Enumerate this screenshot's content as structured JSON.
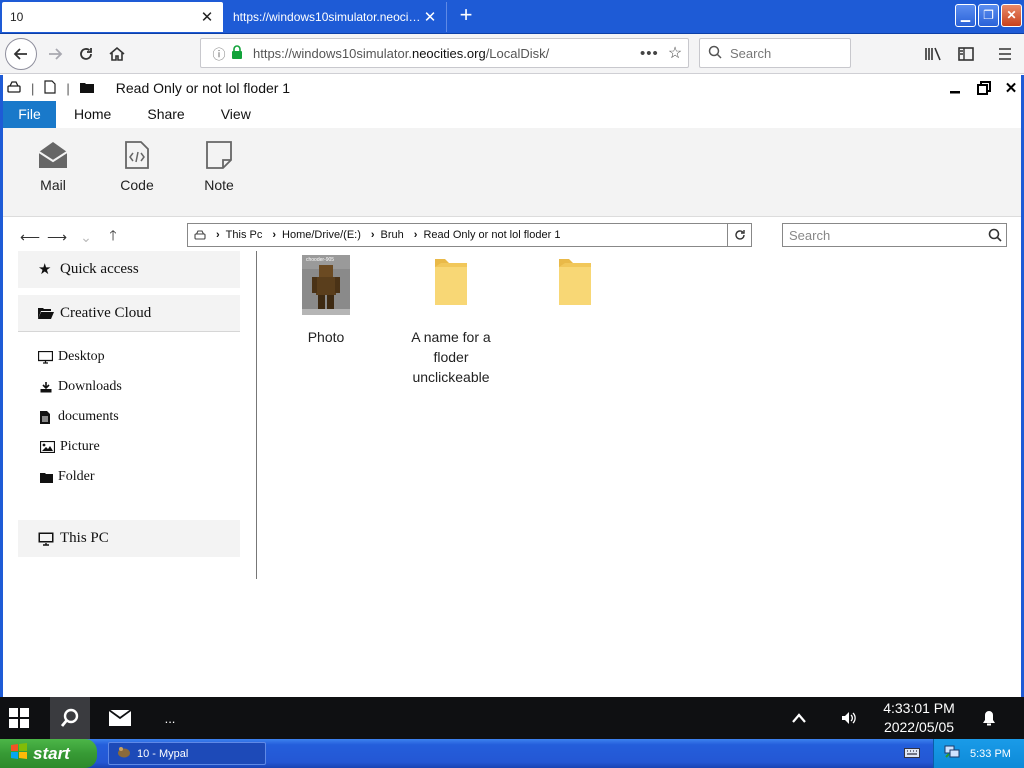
{
  "browser": {
    "tabs": [
      {
        "title": "10",
        "active": true
      },
      {
        "title": "https://windows10simulator.neocities.org/LocalDisk",
        "active": false
      }
    ],
    "url": {
      "prefix": "https://windows10simulator.",
      "domain": "neocities.org",
      "path": "/LocalDisk/"
    },
    "search_placeholder": "Search",
    "icons": [
      "back-icon",
      "forward-icon",
      "reload-icon",
      "home-icon",
      "info-icon",
      "lock-icon",
      "bookmark-star-icon",
      "library-icon",
      "sidebar-icon",
      "menu-icon"
    ]
  },
  "explorer": {
    "title": "Read Only or not lol floder 1",
    "ribbon_tabs": [
      "File",
      "Home",
      "Share",
      "View"
    ],
    "ribbon_buttons": [
      {
        "label": "Mail",
        "icon": "mail-icon"
      },
      {
        "label": "Code",
        "icon": "code-file-icon"
      },
      {
        "label": "Note",
        "icon": "note-icon"
      }
    ],
    "breadcrumb": [
      "This Pc",
      "Home/Drive/(E:)",
      "Bruh",
      "Read Only or not lol floder 1"
    ],
    "search_placeholder": "Search",
    "sidebar": {
      "quick_access": "Quick access",
      "creative_cloud": "Creative Cloud",
      "items": [
        {
          "label": "Desktop",
          "icon": "monitor-icon"
        },
        {
          "label": "Downloads",
          "icon": "download-icon"
        },
        {
          "label": "documents",
          "icon": "document-icon"
        },
        {
          "label": "Picture",
          "icon": "picture-icon"
        },
        {
          "label": "Folder",
          "icon": "folder-icon"
        }
      ],
      "this_pc": "This PC"
    },
    "files": [
      {
        "name": "Photo",
        "type": "image",
        "thumb_caption": "chooder-905"
      },
      {
        "name": "A name for a floder unclickeable",
        "type": "folder"
      },
      {
        "name": "",
        "type": "folder"
      }
    ]
  },
  "taskbar10": {
    "more_label": "...",
    "time": "4:33:01 PM",
    "date": "2022/05/05"
  },
  "taskbarxp": {
    "start_label": "start",
    "task_label": "10 - Mypal",
    "time": "5:33 PM"
  },
  "colors": {
    "xp_blue": "#1e5bd6",
    "file_tab": "#1979ca",
    "folder_yellow": "#f8d775",
    "xp_start_green": "#379a35"
  }
}
